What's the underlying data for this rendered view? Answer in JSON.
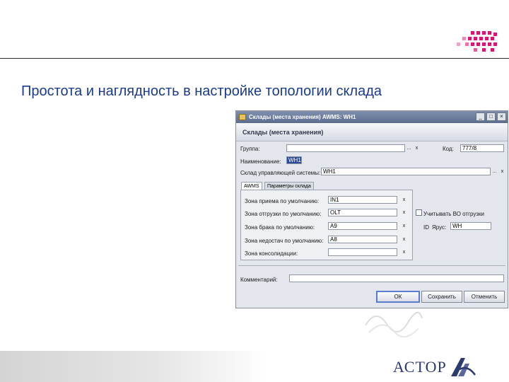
{
  "slide": {
    "title": "Простота и наглядность в настройке топологии склада",
    "brand": "АСТОР"
  },
  "window": {
    "title": "Склады (места хранения) AWMS: WH1",
    "header": "Склады (места хранения)",
    "controls": {
      "minimize": "_",
      "maximize": "□",
      "close": "×"
    }
  },
  "form": {
    "group_label": "Группа:",
    "group_value": "",
    "code_label": "Код:",
    "code_value": "777/8",
    "name_label": "Наименование:",
    "name_value": "WH1",
    "erp_label": "Склад управляющей системы:",
    "erp_value": "WH1",
    "lookup": "...",
    "clear": "x",
    "comment_label": "Комментарий:",
    "comment_value": ""
  },
  "tabs": [
    {
      "label": "AWMS"
    },
    {
      "label": "Параметры склада"
    }
  ],
  "zones": [
    {
      "label": "Зона приема по умолчанию:",
      "value": "IN1"
    },
    {
      "label": "Зона отгрузки по умолчанию:",
      "value": "OLT"
    },
    {
      "label": "Зона брака по умолчанию:",
      "value": "A9"
    },
    {
      "label": "Зона недостач по умолчанию:",
      "value": "A8"
    },
    {
      "label": "Зона консолидации:",
      "value": ""
    }
  ],
  "options": {
    "account_label": "Учитывать ВО отгрузки",
    "id_label": "ID",
    "area_label": "Ярус:",
    "area_value": "WH"
  },
  "buttons": {
    "ok": "ОК",
    "save": "Сохранить",
    "cancel": "Отменить"
  }
}
